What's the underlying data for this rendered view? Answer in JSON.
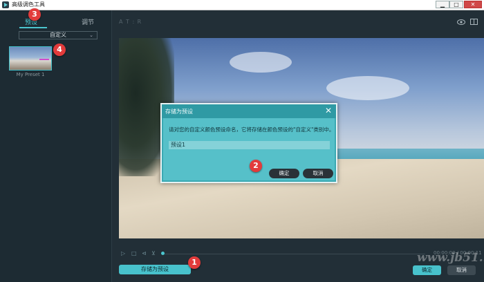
{
  "window": {
    "title": "高级调色工具",
    "minimize": "▁",
    "maximize": "□",
    "close": "✕"
  },
  "left_panel": {
    "tabs": [
      {
        "label": "预设"
      },
      {
        "label": "调节"
      }
    ],
    "dropdown": {
      "value": "自定义"
    },
    "presets": [
      {
        "name": "My Preset 1"
      }
    ]
  },
  "main": {
    "breadcrumb": "A T : R",
    "timecode": "00:00:00 / 00:00:11"
  },
  "dialog": {
    "title": "存储为预设",
    "message": "请对您的自定义颜色预设命名，它将存储在颜色预设的\"自定义\"类别中。",
    "input_value": "预设1",
    "ok_label": "确定",
    "cancel_label": "取消"
  },
  "footer": {
    "save_preset_label": "存储为预设",
    "ok_label": "确定",
    "cancel_label": "取消"
  },
  "markers": [
    "1",
    "2",
    "3",
    "4"
  ],
  "watermark": "www.jb51.net",
  "colors": {
    "accent": "#4cc6cf",
    "dialog_bg": "#3aa9b3",
    "marker": "#e23b3b"
  }
}
